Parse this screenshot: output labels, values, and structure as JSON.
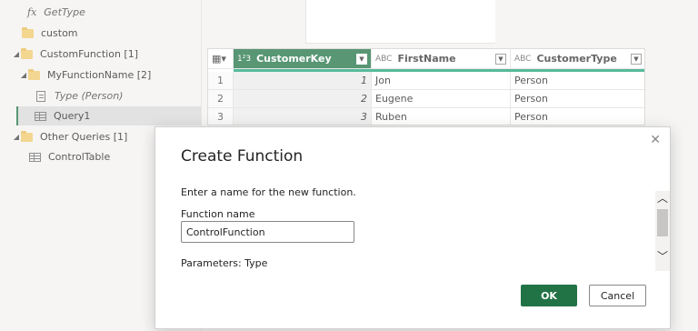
{
  "queries": {
    "items": [
      {
        "label": "GetType",
        "kind": "function",
        "indent": 2,
        "caret": ""
      },
      {
        "label": "custom",
        "kind": "folder",
        "indent": 1,
        "caret": ""
      },
      {
        "label": "CustomFunction [1]",
        "kind": "folder",
        "indent": 0,
        "caret": "◢"
      },
      {
        "label": "MyFunctionName [2]",
        "kind": "folder",
        "indent": 1,
        "caret": "◢"
      },
      {
        "label": "Type (Person)",
        "kind": "parameter",
        "indent": 2,
        "caret": ""
      },
      {
        "label": "Query1",
        "kind": "table",
        "indent": 2,
        "caret": "",
        "selected": true
      },
      {
        "label": "Other Queries [1]",
        "kind": "folder",
        "indent": 0,
        "caret": "◢"
      },
      {
        "label": "ControlTable",
        "kind": "table",
        "indent": 1,
        "caret": ""
      }
    ]
  },
  "grid": {
    "columns": [
      {
        "name": "CustomerKey",
        "type_tag": "1²3"
      },
      {
        "name": "FirstName",
        "type_tag": "ABC"
      },
      {
        "name": "CustomerType",
        "type_tag": "ABC"
      }
    ],
    "rows": [
      {
        "num": "1",
        "key": "1",
        "first": "Jon",
        "type": "Person"
      },
      {
        "num": "2",
        "key": "2",
        "first": "Eugene",
        "type": "Person"
      },
      {
        "num": "3",
        "key": "3",
        "first": "Ruben",
        "type": "Person"
      }
    ]
  },
  "dialog": {
    "title": "Create Function",
    "close_glyph": "✕",
    "prompt": "Enter a name for the new function.",
    "field_label": "Function name",
    "field_value": "ControlFunction",
    "parameters": "Parameters: Type",
    "ok_label": "OK",
    "cancel_label": "Cancel"
  },
  "colors": {
    "accent": "#217346",
    "column_strip": "#1fa37a"
  }
}
